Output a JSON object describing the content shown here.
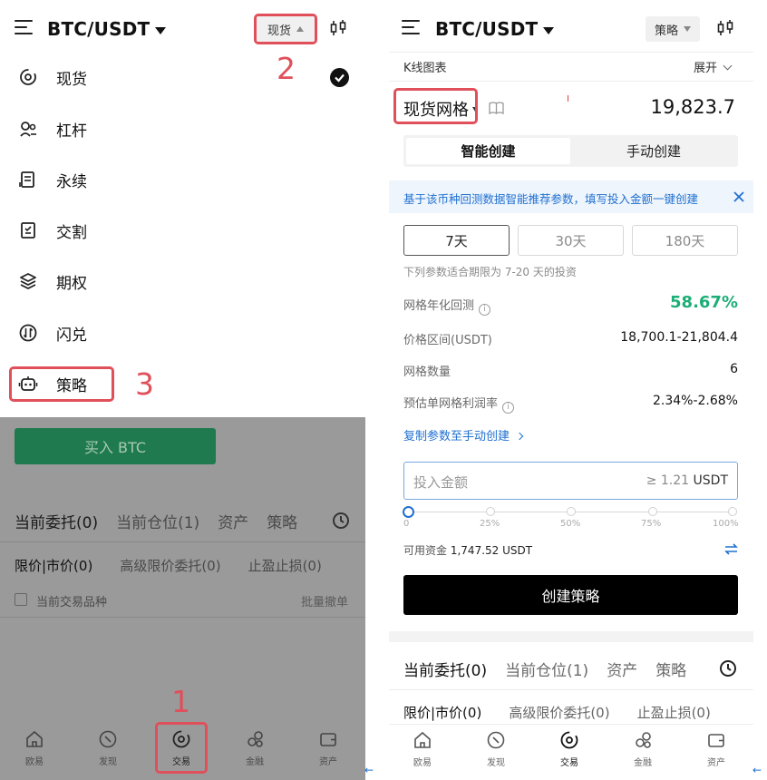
{
  "left": {
    "header": {
      "pair": "BTC/USDT",
      "spot_label": "现货"
    },
    "dropdown": {
      "items": [
        {
          "label": "现货",
          "icon": "spot-icon",
          "selected": true
        },
        {
          "label": "杠杆",
          "icon": "margin-icon"
        },
        {
          "label": "永续",
          "icon": "perpetual-icon"
        },
        {
          "label": "交割",
          "icon": "futures-icon"
        },
        {
          "label": "期权",
          "icon": "options-icon"
        },
        {
          "label": "闪兑",
          "icon": "convert-icon"
        },
        {
          "label": "策略",
          "icon": "bot-icon"
        }
      ]
    },
    "annotations": [
      "1",
      "2",
      "3"
    ],
    "buy_label": "买入 BTC",
    "tabs": [
      "当前委托(0)",
      "当前仓位(1)",
      "资产",
      "策略"
    ],
    "subtabs": [
      "限价|市价(0)",
      "高级限价委托(0)",
      "止盈止损(0)"
    ],
    "current_pair_label": "当前交易品种",
    "cancel_all": "批量撤单"
  },
  "nav": [
    {
      "label": "欧易",
      "icon": "home-icon"
    },
    {
      "label": "发现",
      "icon": "discover-icon"
    },
    {
      "label": "交易",
      "icon": "trade-icon"
    },
    {
      "label": "金融",
      "icon": "finance-icon"
    },
    {
      "label": "资产",
      "icon": "wallet-icon"
    }
  ],
  "right": {
    "header": {
      "pair": "BTC/USDT",
      "strategy_label": "策略"
    },
    "kline_label": "K线图表",
    "expand_label": "展开",
    "grid_title": "现货网格",
    "price": "19,823.7",
    "segments": [
      "智能创建",
      "手动创建"
    ],
    "banner": "基于该币种回测数据智能推荐参数，填写投入金额一键创建",
    "periods": [
      "7天",
      "30天",
      "180天"
    ],
    "hint": "下列参数适合期限为 7-20 天的投资",
    "params": [
      {
        "k": "网格年化回测",
        "v": "58.67%",
        "info": true
      },
      {
        "k": "价格区间(USDT)",
        "v": "18,700.1-21,804.4"
      },
      {
        "k": "网格数量",
        "v": "6"
      },
      {
        "k": "预估单网格利润率",
        "v": "2.34%-2.68%",
        "info": true
      }
    ],
    "copy_link": "复制参数至手动创建",
    "input": {
      "placeholder": "投入金额",
      "min": "≥ 1.21",
      "unit": "USDT"
    },
    "slider": {
      "value": 0,
      "marks": [
        "0",
        "25%",
        "50%",
        "75%",
        "100%"
      ]
    },
    "available": {
      "label": "可用资金",
      "value": "1,747.52 USDT"
    },
    "create_label": "创建策略",
    "tabs": [
      "当前委托(0)",
      "当前仓位(1)",
      "资产",
      "策略"
    ],
    "subtabs": [
      "限价|市价(0)",
      "高级限价委托(0)",
      "止盈止损(0)"
    ]
  },
  "colors": {
    "accent_green": "#1dae77",
    "link_blue": "#2070d0",
    "annotation_red": "#e0505a"
  }
}
